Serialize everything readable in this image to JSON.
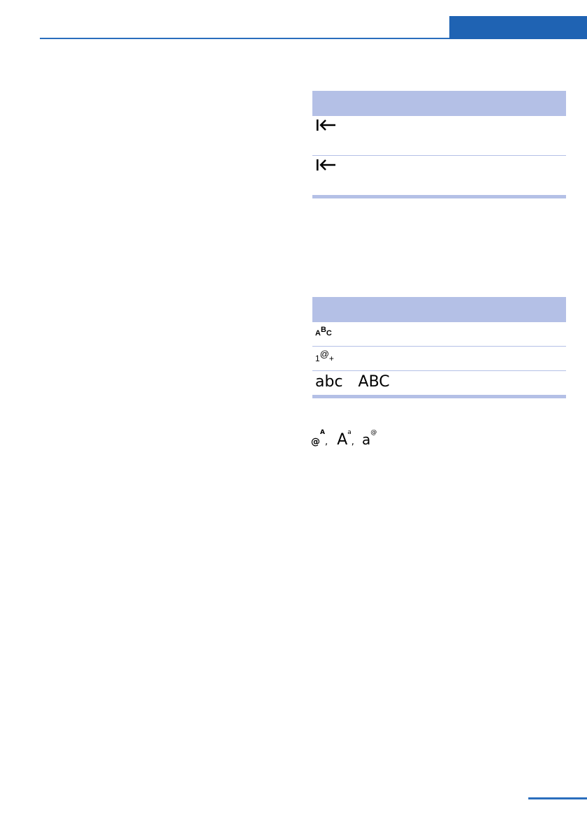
{
  "colors": {
    "accent": "#1f63b3",
    "rule": "#2a6ebd",
    "table_header": "#b4c0e6",
    "table_rule": "#b4c0e6"
  },
  "table1": {
    "header": "",
    "rows": [
      {
        "symbol_icon": "backspace-to-start-icon"
      },
      {
        "symbol_icon": "backspace-to-start-icon"
      }
    ]
  },
  "table2": {
    "header": "",
    "rows": [
      {
        "symbol_parts": [
          "A",
          "B",
          "C"
        ]
      },
      {
        "symbol_parts": [
          "1",
          "@",
          "+"
        ]
      },
      {
        "symbol_lower": "abc",
        "symbol_upper": "ABC"
      }
    ]
  },
  "inline_symbols": {
    "s1_base": "@",
    "s1_sup": "A",
    "sep1": ",",
    "s2_base": "A",
    "s2_sup": "a",
    "sep2": ",",
    "s3_base": "a",
    "s3_sup": "@"
  }
}
